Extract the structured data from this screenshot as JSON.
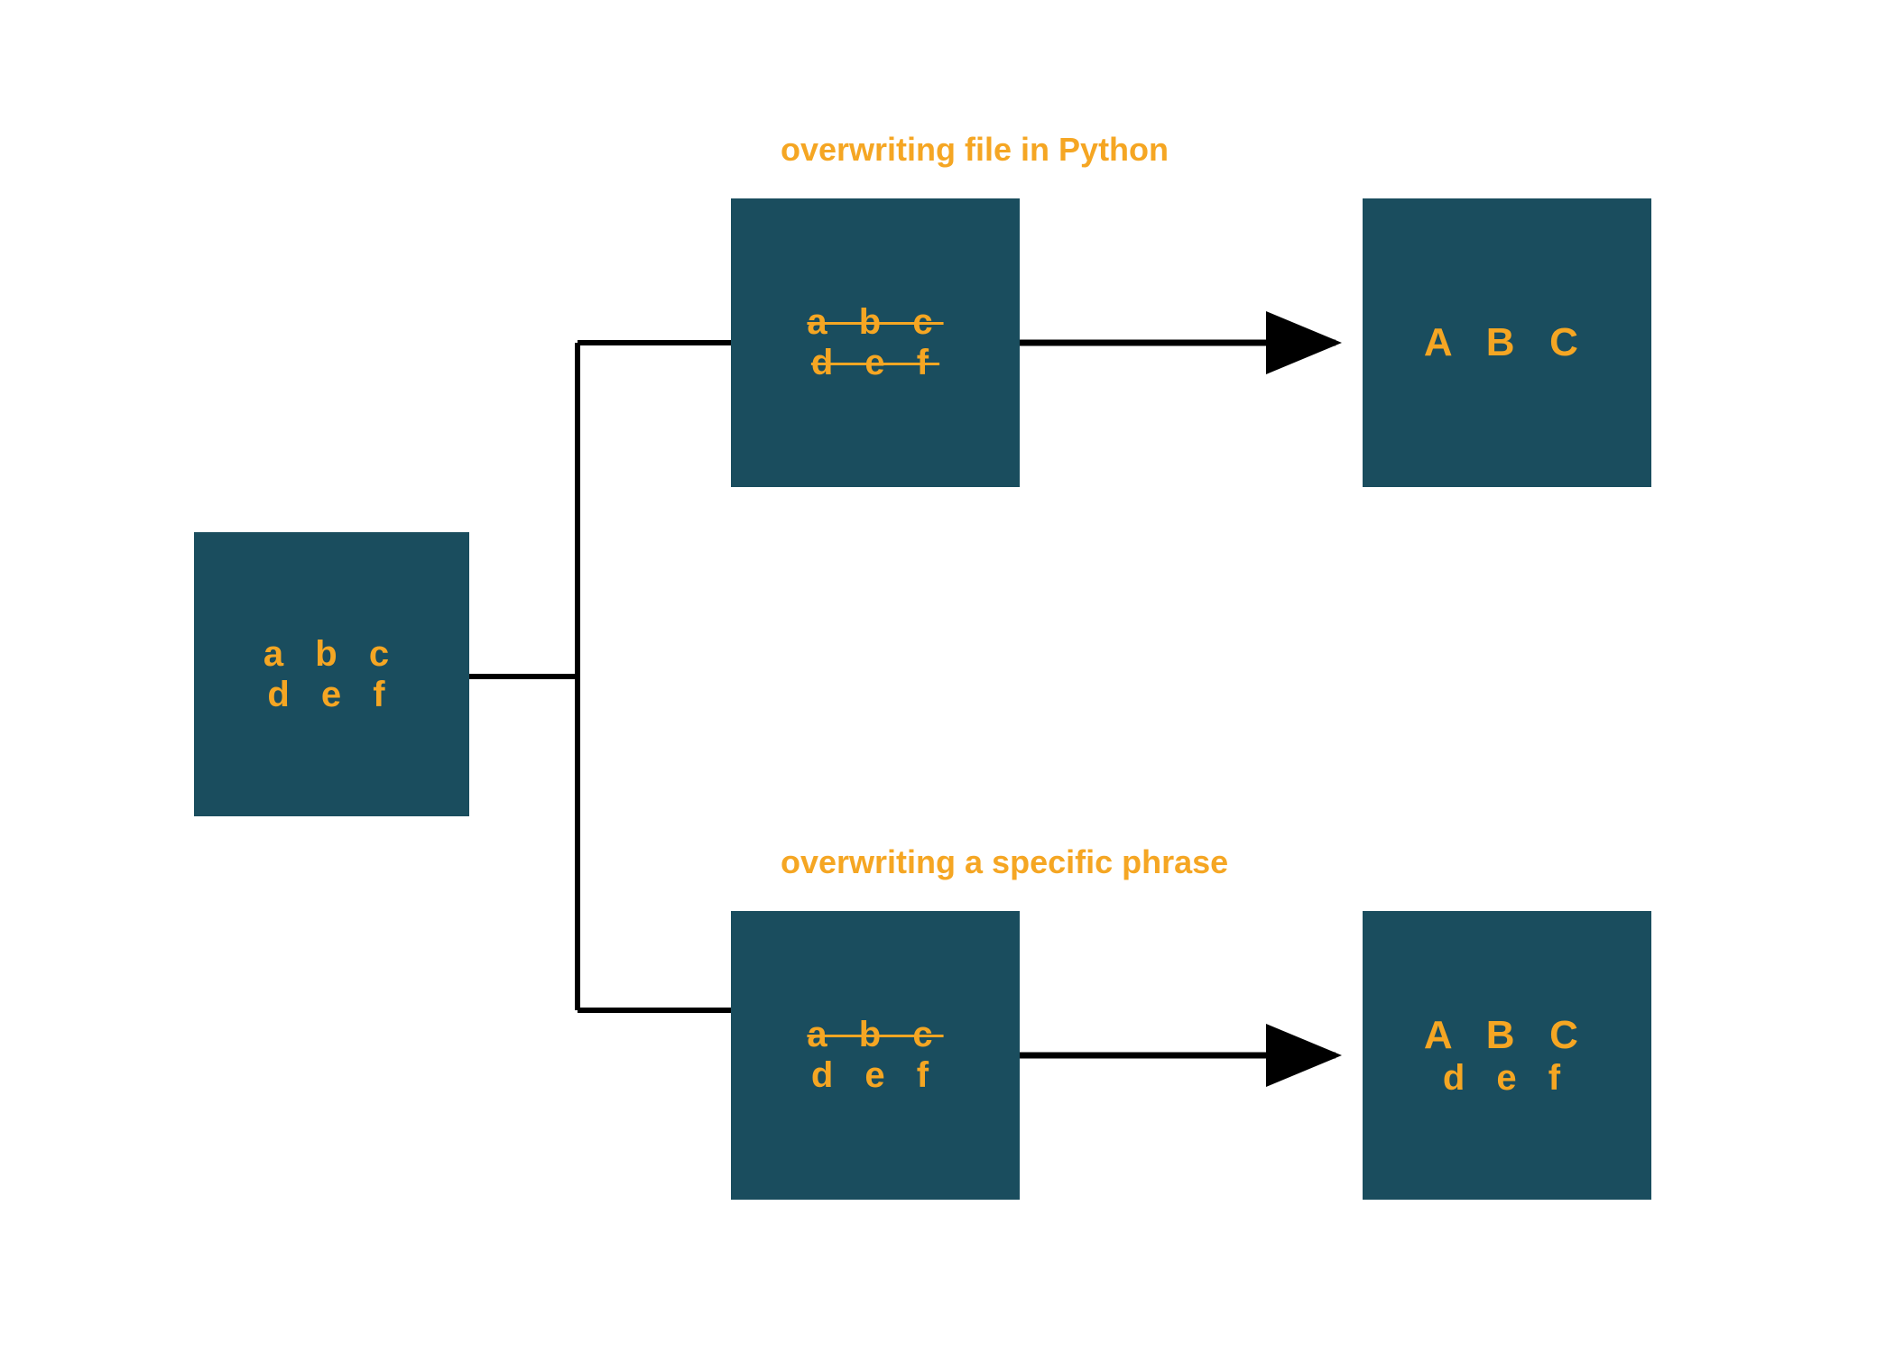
{
  "colors": {
    "box_bg": "#1a4d5e",
    "accent": "#f5a623",
    "arrow": "#000000"
  },
  "labels": {
    "top": "overwriting file in Python",
    "bottom": "overwriting a specific phrase"
  },
  "boxes": {
    "source": {
      "line1": "a b c",
      "line2": "d e f"
    },
    "top_mid": {
      "line1": "a b c",
      "line2": "d e f",
      "line1_strike": true,
      "line2_strike": true
    },
    "top_right": {
      "line1": "A B C",
      "line2": ""
    },
    "bottom_mid": {
      "line1": "a b c",
      "line2": "d e f",
      "line1_strike": true,
      "line2_strike": false
    },
    "bottom_right": {
      "line1": "A B C",
      "line2": "d e f"
    }
  }
}
